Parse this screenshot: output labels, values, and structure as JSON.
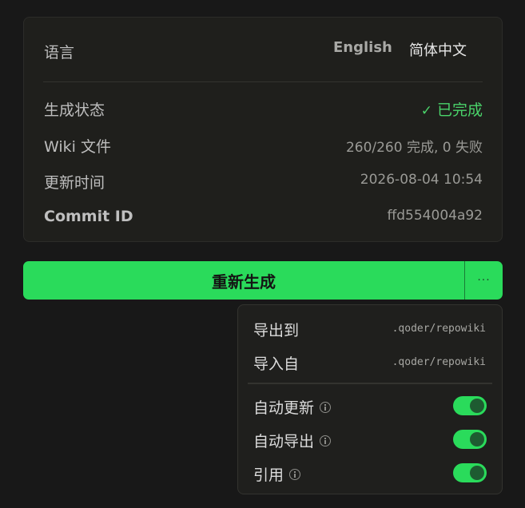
{
  "info": {
    "language_label": "语言",
    "lang_options": [
      "English",
      "简体中文"
    ],
    "selected_lang": "简体中文",
    "rows": [
      {
        "label": "生成状态",
        "value": "已完成"
      },
      {
        "label": "Wiki 文件",
        "value": "260/260 完成, 0 失败"
      },
      {
        "label": "更新时间",
        "value": "2026-08-04 10:54"
      },
      {
        "label": "Commit ID",
        "value": "ffd554004a92"
      }
    ]
  },
  "regenerate": {
    "label": "重新生成",
    "more_label": "···"
  },
  "menu": {
    "export_label": "导出到",
    "export_path": ".qoder/repowiki",
    "import_label": "导入自",
    "import_path": ".qoder/repowiki",
    "toggles": [
      {
        "label": "自动更新",
        "on": true
      },
      {
        "label": "自动导出",
        "on": true
      },
      {
        "label": "引用",
        "on": true
      }
    ]
  },
  "colors": {
    "accent": "#2adb5b",
    "status_ok": "#4ad36a",
    "background": "#181818",
    "card": "#1f1f1c"
  }
}
